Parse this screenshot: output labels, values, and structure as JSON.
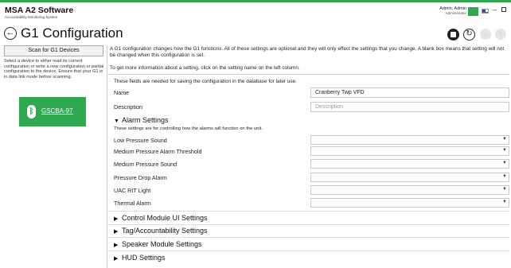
{
  "app": {
    "title": "MSA A2 Software",
    "subtitle": "Accountability Monitoring System"
  },
  "user": {
    "name": "Admin, Admin",
    "role": "Administrator"
  },
  "window": {
    "minimize": "–",
    "maximize": ""
  },
  "page": {
    "back_glyph": "←",
    "title": "G1 Configuration",
    "revert_glyph": "↻",
    "download_glyph": "↓",
    "upload_glyph": "↑"
  },
  "sidebar": {
    "scan_button": "Scan for G1 Devices",
    "help_text": "Select a device to either read its current configuration or write a new configuration or partial configuration to the device. Ensure that your G1 is in data link mode before scanning.",
    "device": {
      "icon_glyph": "ᛒ",
      "label": "GSCBA-97"
    }
  },
  "main": {
    "intro": "A G1 configuration changes how the G1 functions. All of these settings are optional and they will only effect the settings that you change. A blank box means that setting will not be changed when this configuration is set.",
    "intro2": "To get more information about a setting, click on the setting name on the left column.",
    "fields_note": "These fields are needed for saving the configuration in the database for later use.",
    "name": {
      "label": "Name",
      "value": "Cranberry Twp VFD"
    },
    "description": {
      "label": "Description",
      "placeholder": "Description"
    },
    "alarm_section": {
      "arrow": "▼",
      "title": "Alarm Settings",
      "note": "These settings are for controlling how the alarms will function on the unit.",
      "items": [
        {
          "label": "Low Pressure Sound",
          "value": ""
        },
        {
          "label": "Medium Pressure Alarm Threshold",
          "value": ""
        },
        {
          "label": "Medium Pressure Sound",
          "value": ""
        },
        {
          "label": "Pressure Drop Alarm",
          "value": ""
        },
        {
          "label": "UAC RIT Light",
          "value": ""
        },
        {
          "label": "Thermal Alarm",
          "value": ""
        }
      ]
    },
    "collapsed_sections": [
      {
        "arrow": "▶",
        "title": "Control Module UI Settings"
      },
      {
        "arrow": "▶",
        "title": "Tag/Accountability Settings"
      },
      {
        "arrow": "▶",
        "title": "Speaker Module Settings"
      },
      {
        "arrow": "▶",
        "title": "HUD Settings"
      }
    ],
    "dropdown_arrow": "▼"
  },
  "colors": {
    "accent": "#2fa84f"
  }
}
